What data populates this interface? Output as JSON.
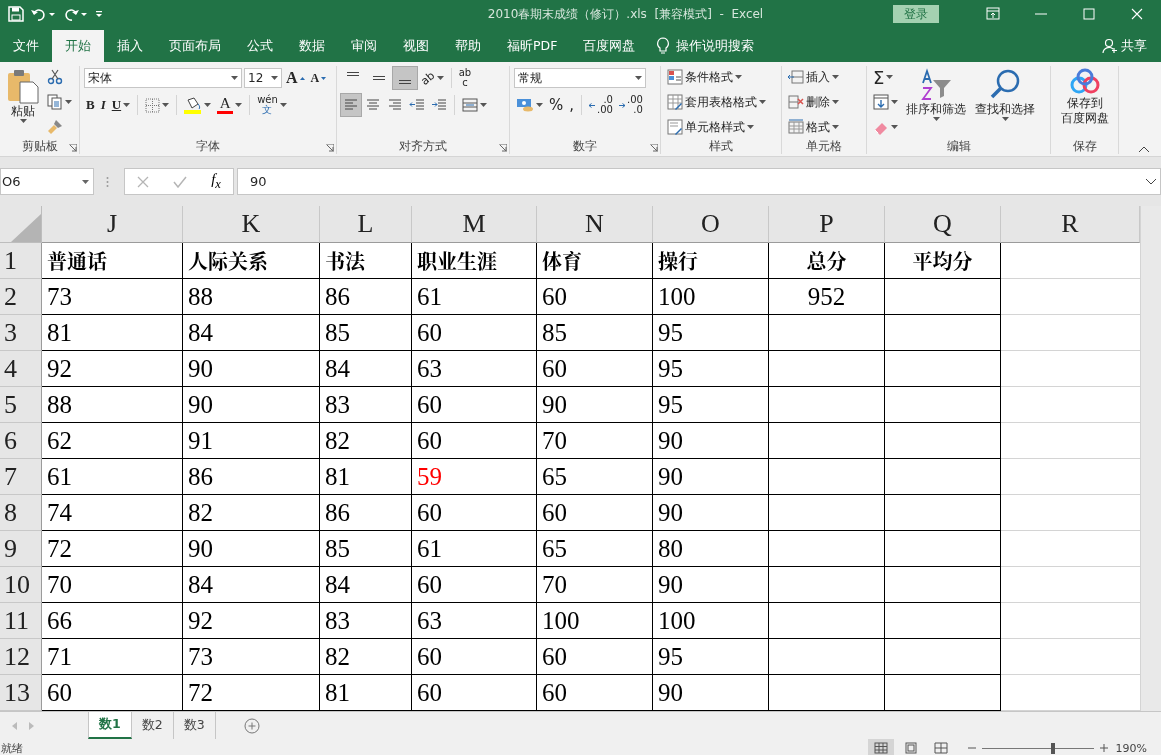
{
  "title_bar": {
    "title": "2010春期末成绩（修订）.xls  [兼容模式]  -  Excel",
    "login": "登录"
  },
  "menu_tabs": [
    {
      "label": "文件",
      "selected": false
    },
    {
      "label": "开始",
      "selected": true
    },
    {
      "label": "插入",
      "selected": false
    },
    {
      "label": "页面布局",
      "selected": false
    },
    {
      "label": "公式",
      "selected": false
    },
    {
      "label": "数据",
      "selected": false
    },
    {
      "label": "审阅",
      "selected": false
    },
    {
      "label": "视图",
      "selected": false
    },
    {
      "label": "帮助",
      "selected": false
    },
    {
      "label": "福昕PDF",
      "selected": false
    },
    {
      "label": "百度网盘",
      "selected": false
    }
  ],
  "tell_me": "操作说明搜索",
  "share": "共享",
  "ribbon": {
    "clipboard": {
      "paste": "粘贴",
      "label": "剪贴板"
    },
    "font": {
      "name": "宋体",
      "size": "12",
      "grow": "A",
      "shrink": "A",
      "bold": "B",
      "italic": "I",
      "underline": "U",
      "font_color": "A",
      "phonetic": [
        "wén",
        "文"
      ],
      "label": "字体"
    },
    "alignment": {
      "vertical": [
        {
          "selected": false
        },
        {
          "selected": false
        },
        {
          "selected": true
        }
      ],
      "orientation": "ab",
      "wrap": [
        "ab",
        "c"
      ],
      "horizontal": [
        {
          "selected": true
        },
        {
          "selected": false
        },
        {
          "selected": false
        }
      ],
      "label": "对齐方式"
    },
    "number": {
      "format": "常规",
      "percent": "%",
      "comma": ",",
      "increase_decimal": [
        ".0",
        ".00"
      ],
      "decrease_decimal": [
        ".00",
        ".0"
      ],
      "label": "数字"
    },
    "styles": {
      "items": [
        "条件格式",
        "套用表格格式",
        "单元格样式"
      ],
      "label": "样式"
    },
    "cells": {
      "items": [
        "插入",
        "删除",
        "格式"
      ],
      "label": "单元格"
    },
    "editing": {
      "sum": "Σ",
      "sort": "排序和筛选",
      "find": "查找和选择",
      "label": "编辑"
    },
    "save": {
      "lines": [
        "保存到",
        "百度网盘"
      ],
      "label": "保存"
    }
  },
  "formula_bar": {
    "name_box": "O6",
    "fx": "f$_{x}$",
    "value": "90"
  },
  "sheet": {
    "columns": [
      {
        "label": "J",
        "centered": false
      },
      {
        "label": "K",
        "centered": false
      },
      {
        "label": "L",
        "centered": false
      },
      {
        "label": "M",
        "centered": false
      },
      {
        "label": "N",
        "centered": false
      },
      {
        "label": "O",
        "centered": false
      },
      {
        "label": "P",
        "centered": true
      },
      {
        "label": "Q",
        "centered": true
      },
      {
        "label": "R"
      }
    ],
    "rows": [
      {
        "label": "1",
        "bold": true,
        "cells": [
          "普通话",
          "人际关系",
          "书法",
          "职业生涯",
          "体育",
          "操行",
          "总分",
          "平均分"
        ]
      },
      {
        "label": "2",
        "bold": false,
        "cells": [
          "73",
          "88",
          "86",
          "61",
          "60",
          "100",
          "952"
        ]
      },
      {
        "label": "3",
        "bold": false,
        "cells": [
          "81",
          "84",
          "85",
          "60",
          "85",
          "95"
        ]
      },
      {
        "label": "4",
        "bold": false,
        "cells": [
          "92",
          "90",
          "84",
          "63",
          "60",
          "95"
        ]
      },
      {
        "label": "5",
        "bold": false,
        "cells": [
          "88",
          "90",
          "83",
          "60",
          "90",
          "95"
        ]
      },
      {
        "label": "6",
        "bold": false,
        "cells": [
          "62",
          "91",
          "82",
          "60",
          "70",
          "90"
        ]
      },
      {
        "label": "7",
        "bold": false,
        "cells": [
          "61",
          "86",
          "81",
          {
            "text": "59",
            "color": "#ff0000"
          },
          "65",
          "90"
        ]
      },
      {
        "label": "8",
        "bold": false,
        "cells": [
          "74",
          "82",
          "86",
          "60",
          "60",
          "90"
        ]
      },
      {
        "label": "9",
        "bold": false,
        "cells": [
          "72",
          "90",
          "85",
          "61",
          "65",
          "80"
        ]
      },
      {
        "label": "10",
        "bold": false,
        "cells": [
          "70",
          "84",
          "84",
          "60",
          "70",
          "90"
        ]
      },
      {
        "label": "11",
        "bold": false,
        "cells": [
          "66",
          "92",
          "83",
          "63",
          "100",
          "100"
        ]
      },
      {
        "label": "12",
        "bold": false,
        "cells": [
          "71",
          "73",
          "82",
          "60",
          "60",
          "95"
        ]
      },
      {
        "label": "13",
        "bold": false,
        "cells": [
          "60",
          "72",
          "81",
          "60",
          "60",
          "90"
        ]
      }
    ]
  },
  "sheet_tabs": [
    {
      "label": "数1",
      "selected": true
    },
    {
      "label": "数2",
      "selected": false
    },
    {
      "label": "数3",
      "selected": false
    }
  ],
  "status_bar": {
    "status": "就绪",
    "view": [
      {
        "selected": true
      },
      {
        "selected": false
      },
      {
        "selected": false
      }
    ],
    "zoom": {
      "level": 0.62
    },
    "zoom_label": "190%"
  }
}
